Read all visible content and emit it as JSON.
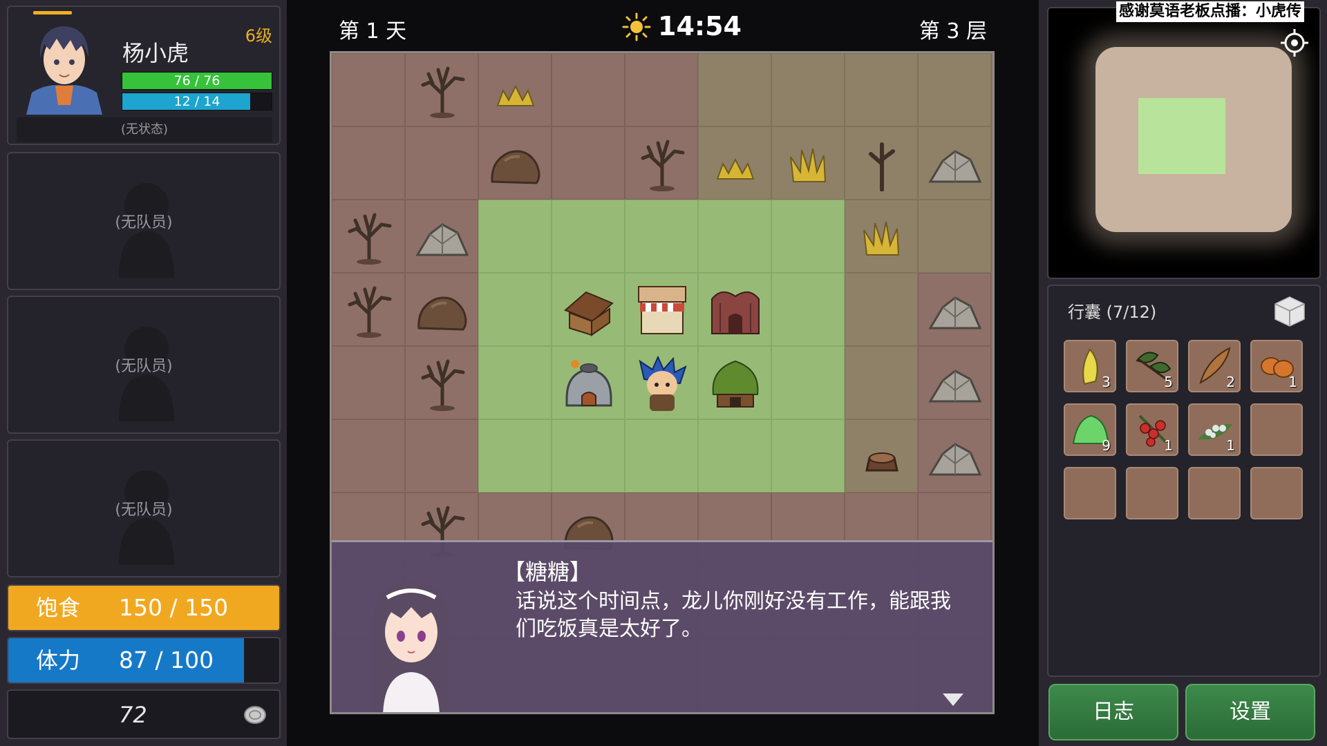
{
  "hero": {
    "name": "杨小虎",
    "level": "6级",
    "hp_text": "76 / 76",
    "hp_fraction": 1.0,
    "mp_text": "12 / 14",
    "mp_fraction": 0.857,
    "status": "(无状态)"
  },
  "party": {
    "empty_label": "(无队员)",
    "members": [
      "(无队员)",
      "(无队员)",
      "(无队员)"
    ]
  },
  "stats": {
    "food_label": "饱食",
    "food_value": "150  /  150",
    "food_fraction": 1.0,
    "stamina_label": "体力",
    "stamina_value": "87  /  100",
    "stamina_fraction": 0.87,
    "coins": "72"
  },
  "topbar": {
    "day": "第 1 天",
    "time": "14:54",
    "floor": "第 3 层"
  },
  "map": {
    "rows": [
      [
        "b",
        "tree",
        "grass",
        "b",
        "b",
        "b",
        "o",
        "o",
        "o"
      ],
      [
        "b",
        "b",
        "rock",
        "b",
        "tree",
        "grass",
        "grass2",
        "tree2",
        "rock2"
      ],
      [
        "tree",
        "rock2",
        "g",
        "g",
        "g",
        "g",
        "g",
        "grass2",
        "o"
      ],
      [
        "tree",
        "rock",
        "g",
        "hut",
        "shop",
        "temple",
        "g",
        "o",
        "rock2"
      ],
      [
        "b",
        "tree",
        "g",
        "kiln",
        "player",
        "grasshut",
        "g",
        "o",
        "rock2"
      ],
      [
        "b",
        "b",
        "g",
        "g",
        "g",
        "g",
        "g",
        "stump",
        "rock2"
      ],
      [
        "b",
        "tree",
        "b",
        "rock",
        "b",
        "b",
        "b",
        "b",
        "b"
      ],
      [
        "b",
        "b",
        "b",
        "b",
        "b",
        "b",
        "b",
        "b",
        "b"
      ],
      [
        "b",
        "b",
        "b",
        "b",
        "b",
        "b",
        "b",
        "b",
        "b"
      ]
    ]
  },
  "dialog": {
    "speaker": "【糖糖】",
    "text": "话说这个时间点，龙儿你刚好没有工作，能跟我们吃饭真是太好了。"
  },
  "minimap": {
    "overlay": "感谢莫语老板点播：小虎传"
  },
  "inventory": {
    "title": "行囊 (7/12)",
    "slots": [
      {
        "item": "yellow-herb",
        "count": "3",
        "color": "#e8d84a"
      },
      {
        "item": "dark-leaf",
        "count": "5",
        "color": "#3f6a2c"
      },
      {
        "item": "brown-feather",
        "count": "2",
        "color": "#b0743e"
      },
      {
        "item": "orange-fruit",
        "count": "1",
        "color": "#d6762e"
      },
      {
        "item": "green-powder",
        "count": "9",
        "color": "#6bd56b"
      },
      {
        "item": "red-berries",
        "count": "1",
        "color": "#c9302c"
      },
      {
        "item": "white-flowers",
        "count": "1",
        "color": "#dfe9e9"
      },
      {
        "item": "",
        "count": "",
        "color": ""
      },
      {
        "item": "",
        "count": "",
        "color": ""
      },
      {
        "item": "",
        "count": "",
        "color": ""
      },
      {
        "item": "",
        "count": "",
        "color": ""
      },
      {
        "item": "",
        "count": "",
        "color": ""
      }
    ]
  },
  "buttons": {
    "log": "日志",
    "settings": "设置"
  }
}
